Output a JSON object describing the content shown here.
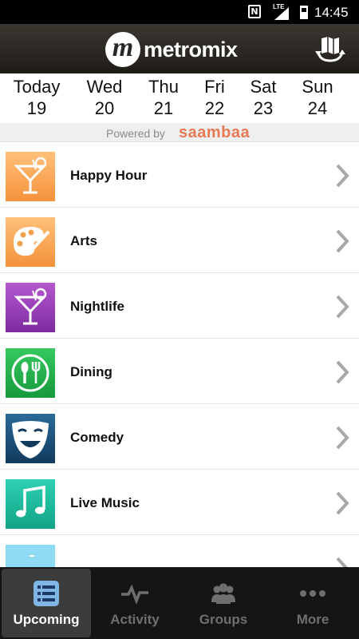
{
  "status_bar": {
    "time": "14:45",
    "network": "LTE",
    "nfc": "N"
  },
  "header": {
    "logo_letter": "m",
    "app_name": "metromix",
    "map_icon": "map-refresh-icon"
  },
  "dates": [
    {
      "day": "Today",
      "num": "19"
    },
    {
      "day": "Wed",
      "num": "20"
    },
    {
      "day": "Thu",
      "num": "21"
    },
    {
      "day": "Fri",
      "num": "22"
    },
    {
      "day": "Sat",
      "num": "23"
    },
    {
      "day": "Sun",
      "num": "24"
    }
  ],
  "powered": {
    "label": "Powered by",
    "brand": "saambaa"
  },
  "categories": [
    {
      "label": "Happy Hour",
      "icon": "cocktail-icon",
      "color": "#f5a14a"
    },
    {
      "label": "Arts",
      "icon": "palette-icon",
      "color": "#f5a14a"
    },
    {
      "label": "Nightlife",
      "icon": "cocktail-icon",
      "color": "#9a3fb5"
    },
    {
      "label": "Dining",
      "icon": "fork-spoon-icon",
      "color": "#1fb04a"
    },
    {
      "label": "Comedy",
      "icon": "comedy-mask-icon",
      "color": "#1c4f7a"
    },
    {
      "label": "Live Music",
      "icon": "music-note-icon",
      "color": "#19b89a"
    },
    {
      "label": "",
      "icon": "category-icon",
      "color": "#7fd3f0"
    }
  ],
  "tabs": [
    {
      "label": "Upcoming",
      "icon": "list-icon",
      "active": true
    },
    {
      "label": "Activity",
      "icon": "pulse-icon",
      "active": false
    },
    {
      "label": "Groups",
      "icon": "people-icon",
      "active": false
    },
    {
      "label": "More",
      "icon": "more-dots-icon",
      "active": false
    }
  ]
}
